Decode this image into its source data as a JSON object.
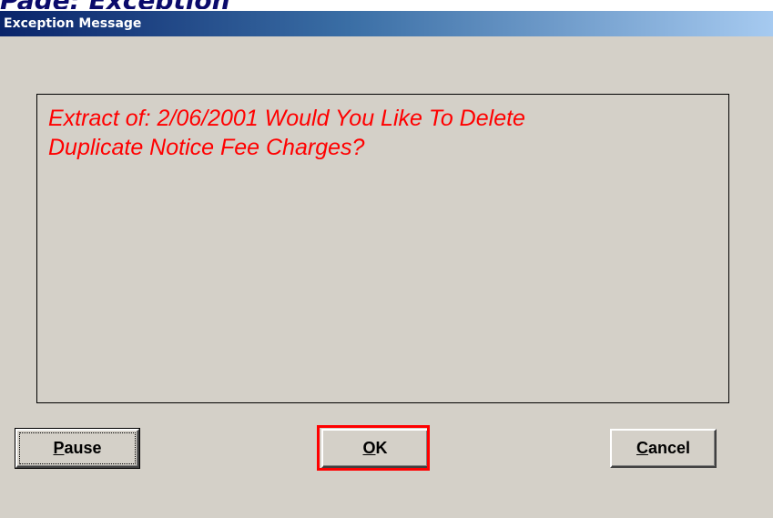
{
  "window": {
    "title": "Exception Message",
    "clipped_header_text": "Page: Exception Message"
  },
  "message": {
    "text": " Extract of: 2/06/2001 Would You Like To Delete\nDuplicate Notice Fee Charges?"
  },
  "buttons": {
    "pause": {
      "accel": "P",
      "rest": "ause"
    },
    "ok": {
      "accel": "O",
      "rest": "K"
    },
    "cancel": {
      "accel": "C",
      "rest": "ancel"
    }
  },
  "colors": {
    "message_text": "#ff0000",
    "highlight": "#ff0000",
    "titlebar_start": "#0a246a",
    "titlebar_end": "#a6caf0",
    "dialog_bg": "#d4d0c8"
  }
}
